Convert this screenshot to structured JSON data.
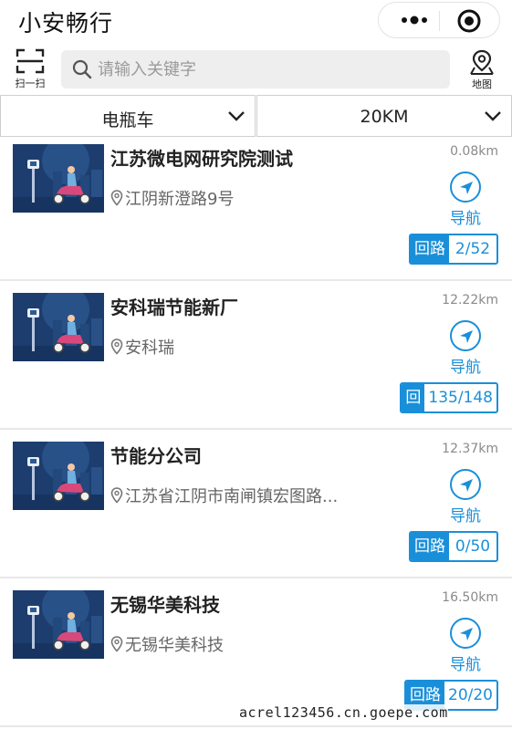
{
  "app": {
    "title": "小安畅行"
  },
  "toolbar": {
    "scan_label": "扫一扫",
    "search_placeholder": "请输入关键字",
    "map_label": "地图"
  },
  "filters": {
    "vehicle_type": "电瓶车",
    "distance_range": "20KM"
  },
  "stations": [
    {
      "name": "江苏微电网研究院测试",
      "address": "江阴新澄路9号",
      "distance": "0.08km",
      "nav_label": "导航",
      "tag": "回路",
      "count": "2/52"
    },
    {
      "name": "安科瑞节能新厂",
      "address": "安科瑞",
      "distance": "12.22km",
      "nav_label": "导航",
      "tag": "回",
      "count": "135/148"
    },
    {
      "name": "节能分公司",
      "address": "江苏省江阴市南闸镇宏图路...",
      "distance": "12.37km",
      "nav_label": "导航",
      "tag": "回路",
      "count": "0/50"
    },
    {
      "name": "无锡华美科技",
      "address": "无锡华美科技",
      "distance": "16.50km",
      "nav_label": "导航",
      "tag": "回路",
      "count": "20/20"
    }
  ],
  "watermark": "acrel123456.cn.goepe.com",
  "colors": {
    "accent": "#1a8fd9",
    "thumb_bg": "#1c3d6e"
  },
  "icons": [
    "more-icon",
    "close-icon",
    "scan-icon",
    "search-icon",
    "map-pin-icon",
    "chevron-down-icon",
    "location-pin-icon",
    "navigate-arrow-icon"
  ]
}
